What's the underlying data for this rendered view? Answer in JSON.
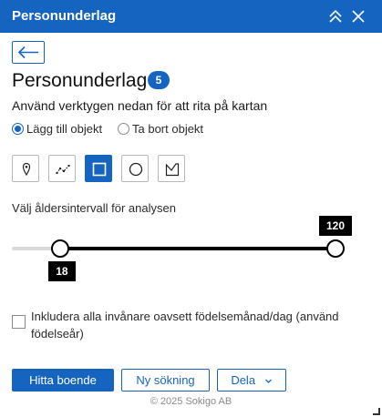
{
  "header": {
    "title": "Personunderlag"
  },
  "panel": {
    "title": "Personunderlag",
    "badge": "5",
    "instruction": "Använd verktygen nedan för att rita på kartan"
  },
  "mode": {
    "options": [
      {
        "label": "Lägg till objekt",
        "checked": true
      },
      {
        "label": "Ta bort objekt",
        "checked": false
      }
    ]
  },
  "tools": [
    {
      "icon": "point-pin-icon",
      "active": false
    },
    {
      "icon": "polyline-icon",
      "active": false
    },
    {
      "icon": "rectangle-icon",
      "active": true
    },
    {
      "icon": "circle-icon",
      "active": false
    },
    {
      "icon": "freehand-polygon-icon",
      "active": false
    }
  ],
  "age_slider": {
    "label": "Välj åldersintervall för analysen",
    "min": 0,
    "max": 120,
    "low": 18,
    "high": 120,
    "low_label": "18",
    "high_label": "120"
  },
  "include_all": {
    "label": "Inkludera alla invånare oavsett födelsemånad/dag (använd födelseår)",
    "checked": false
  },
  "actions": {
    "find": "Hitta boende",
    "new_search": "Ny sökning",
    "share": "Dela"
  },
  "footer": {
    "text": "© 2025 Sokigo AB"
  },
  "colors": {
    "accent": "#1565c0",
    "slider": "#000000"
  }
}
